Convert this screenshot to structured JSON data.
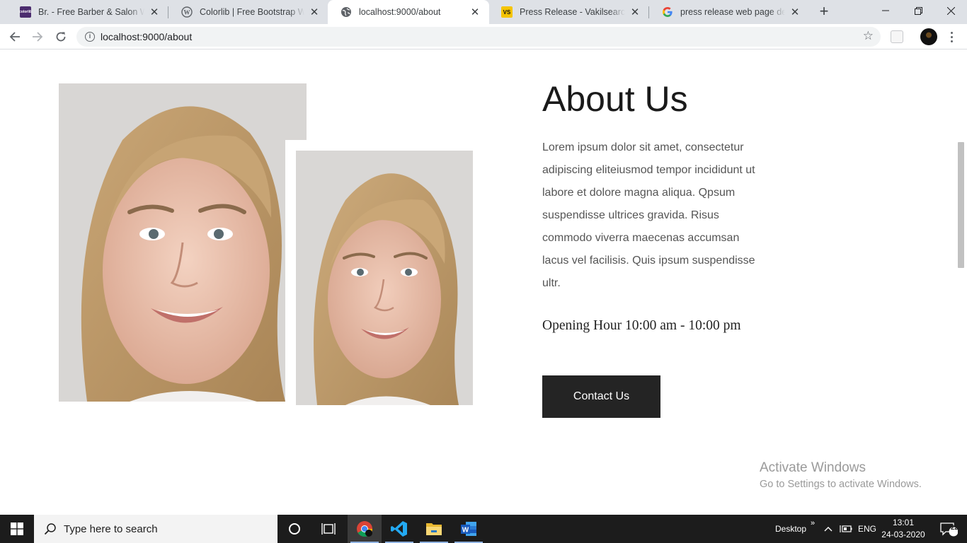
{
  "browser": {
    "tabs": [
      {
        "title": "Br. - Free Barber & Salon Website",
        "favicon": "colorlib-icon",
        "favicon_text": "colorlib",
        "favicon_color": "#4b2c6e"
      },
      {
        "title": "Colorlib | Free Bootstrap Website",
        "favicon": "wordpress-icon"
      },
      {
        "title": "localhost:9000/about",
        "favicon": "globe-icon",
        "active": true
      },
      {
        "title": "Press Release - Vakilsearch.com",
        "favicon": "vakilsearch-icon",
        "favicon_text": "VS",
        "favicon_color": "#f5c400"
      },
      {
        "title": "press release web page design",
        "favicon": "google-icon"
      }
    ],
    "url": "localhost:9000/about"
  },
  "page": {
    "heading": "About Us",
    "paragraph": "Lorem ipsum dolor sit amet, consectetur adipiscing eliteiusmod tempor incididunt ut labore et dolore magna aliqua. Qpsum suspendisse ultrices gravida. Risus commodo viverra maecenas accumsan lacus vel facilisis. Quis ipsum suspendisse ultr.",
    "opening_hours": "Opening Hour 10:00 am - 10:00 pm",
    "contact_button": "Contact Us"
  },
  "watermark": {
    "line1": "Activate Windows",
    "line2": "Go to Settings to activate Windows."
  },
  "taskbar": {
    "search_placeholder": "Type here to search",
    "desktop_label": "Desktop",
    "language": "ENG",
    "time": "13:01",
    "date": "24-03-2020",
    "notification_count": "22"
  },
  "colors": {
    "button_bg": "#242424",
    "heading": "#1a1a1a",
    "body_text": "#555555"
  }
}
